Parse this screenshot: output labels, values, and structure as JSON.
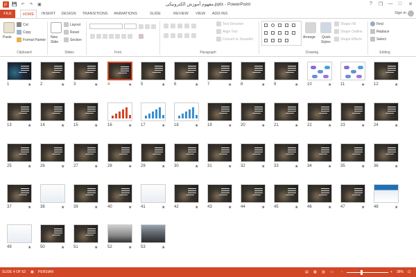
{
  "title": "مفهوم آموزش الکترونیکی.pptx - PowerPoint",
  "window": {
    "help": "?",
    "restore": "❐",
    "minimize": "—",
    "maximize": "□",
    "close": "✕"
  },
  "qat": {
    "save": "💾",
    "undo": "↶",
    "redo": "↷",
    "start": "▣"
  },
  "tabs": {
    "file": "FILE",
    "home": "HOME",
    "insert": "INSERT",
    "design": "DESIGN",
    "transitions": "TRANSITIONS",
    "animations": "ANIMATIONS",
    "slideshow": "SLIDE SHOW",
    "review": "REVIEW",
    "view": "VIEW",
    "addins": "ADD-INS"
  },
  "signin": "Sign in",
  "ribbon": {
    "clipboard": {
      "paste": "Paste",
      "cut": "Cut",
      "copy": "Copy",
      "format_painter": "Format Painter",
      "label": "Clipboard"
    },
    "slides": {
      "new_slide_line1": "New",
      "new_slide_line2": "Slide",
      "layout": "Layout",
      "reset": "Reset",
      "section": "Section",
      "label": "Slides"
    },
    "font": {
      "label": "Font"
    },
    "paragraph": {
      "text_direction": "Text Direction",
      "align_text": "Align Text",
      "convert_smartart": "Convert to SmartArt",
      "label": "Paragraph"
    },
    "drawing": {
      "arrange": "Arrange",
      "quick_styles_line1": "Quick",
      "quick_styles_line2": "Styles",
      "shape_fill": "Shape Fill",
      "shape_outline": "Shape Outline",
      "shape_effects": "Shape Effects",
      "label": "Drawing"
    },
    "editing": {
      "find": "Find",
      "replace": "Replace",
      "select": "Select",
      "label": "Editing"
    }
  },
  "slides": [
    {
      "n": "1",
      "star": "★",
      "kind": "photo",
      "selected": false
    },
    {
      "n": "2",
      "star": "★",
      "kind": "dark",
      "selected": false
    },
    {
      "n": "3",
      "star": "★",
      "kind": "dark",
      "selected": false
    },
    {
      "n": "4",
      "star": "★",
      "kind": "dark",
      "selected": true
    },
    {
      "n": "5",
      "star": "★",
      "kind": "dark",
      "selected": false
    },
    {
      "n": "6",
      "star": "★",
      "kind": "dark",
      "selected": false
    },
    {
      "n": "7",
      "star": "★",
      "kind": "dark",
      "selected": false
    },
    {
      "n": "8",
      "star": "★",
      "kind": "dark",
      "selected": false
    },
    {
      "n": "9",
      "star": "★",
      "kind": "dark",
      "selected": false
    },
    {
      "n": "10",
      "star": "★",
      "kind": "diagram",
      "selected": false
    },
    {
      "n": "11",
      "star": "★",
      "kind": "diagram",
      "selected": false
    },
    {
      "n": "12",
      "star": "★",
      "kind": "dark",
      "selected": false
    },
    {
      "n": "13",
      "star": "★",
      "kind": "dark",
      "selected": false
    },
    {
      "n": "14",
      "star": "★",
      "kind": "dark",
      "selected": false
    },
    {
      "n": "15",
      "star": "★",
      "kind": "dark",
      "selected": false
    },
    {
      "n": "16",
      "star": "★",
      "kind": "chart",
      "selected": false
    },
    {
      "n": "17",
      "star": "★",
      "kind": "bars",
      "selected": false
    },
    {
      "n": "18",
      "star": "★",
      "kind": "bars",
      "selected": false
    },
    {
      "n": "19",
      "star": "★",
      "kind": "dark",
      "selected": false
    },
    {
      "n": "20",
      "star": "★",
      "kind": "dark",
      "selected": false
    },
    {
      "n": "21",
      "star": "★",
      "kind": "dark",
      "selected": false
    },
    {
      "n": "22",
      "star": "★",
      "kind": "dark",
      "selected": false
    },
    {
      "n": "23",
      "star": "★",
      "kind": "dark",
      "selected": false
    },
    {
      "n": "24",
      "star": "★",
      "kind": "dark",
      "selected": false
    },
    {
      "n": "25",
      "star": "★",
      "kind": "dark",
      "selected": false
    },
    {
      "n": "26",
      "star": "★",
      "kind": "dark",
      "selected": false
    },
    {
      "n": "27",
      "star": "★",
      "kind": "dark",
      "selected": false
    },
    {
      "n": "28",
      "star": "★",
      "kind": "dark",
      "selected": false
    },
    {
      "n": "29",
      "star": "★",
      "kind": "dark",
      "selected": false
    },
    {
      "n": "30",
      "star": "★",
      "kind": "dark",
      "selected": false
    },
    {
      "n": "31",
      "star": "★",
      "kind": "dark",
      "selected": false
    },
    {
      "n": "32",
      "star": "★",
      "kind": "dark",
      "selected": false
    },
    {
      "n": "33",
      "star": "★",
      "kind": "dark",
      "selected": false
    },
    {
      "n": "34",
      "star": "★",
      "kind": "dark",
      "selected": false
    },
    {
      "n": "35",
      "star": "★",
      "kind": "dark",
      "selected": false
    },
    {
      "n": "36",
      "star": "★",
      "kind": "dark",
      "selected": false
    },
    {
      "n": "37",
      "star": "★",
      "kind": "dark",
      "selected": false
    },
    {
      "n": "38",
      "star": "★",
      "kind": "light",
      "selected": false
    },
    {
      "n": "39",
      "star": "★",
      "kind": "dark",
      "selected": false
    },
    {
      "n": "40",
      "star": "★",
      "kind": "dark",
      "selected": false
    },
    {
      "n": "41",
      "star": "★",
      "kind": "light",
      "selected": false
    },
    {
      "n": "42",
      "star": "★",
      "kind": "dark",
      "selected": false
    },
    {
      "n": "43",
      "star": "★",
      "kind": "dark",
      "selected": false
    },
    {
      "n": "44",
      "star": "★",
      "kind": "dark",
      "selected": false
    },
    {
      "n": "45",
      "star": "★",
      "kind": "dark",
      "selected": false
    },
    {
      "n": "46",
      "star": "★",
      "kind": "dark",
      "selected": false
    },
    {
      "n": "47",
      "star": "★",
      "kind": "dark",
      "selected": false
    },
    {
      "n": "48",
      "star": "★",
      "kind": "blue",
      "selected": false
    },
    {
      "n": "49",
      "star": "★",
      "kind": "light",
      "selected": false
    },
    {
      "n": "50",
      "star": "★",
      "kind": "dark",
      "selected": false
    },
    {
      "n": "51",
      "star": "★",
      "kind": "dark",
      "selected": false
    },
    {
      "n": "52",
      "star": "★",
      "kind": "photo2",
      "selected": false
    },
    {
      "n": "53",
      "star": "★",
      "kind": "photo3",
      "selected": false
    }
  ],
  "status": {
    "slide_info": "SLIDE 4 OF 53",
    "language": "PERSIAN",
    "zoom": "38%"
  },
  "colors": {
    "accent": "#d24726"
  }
}
